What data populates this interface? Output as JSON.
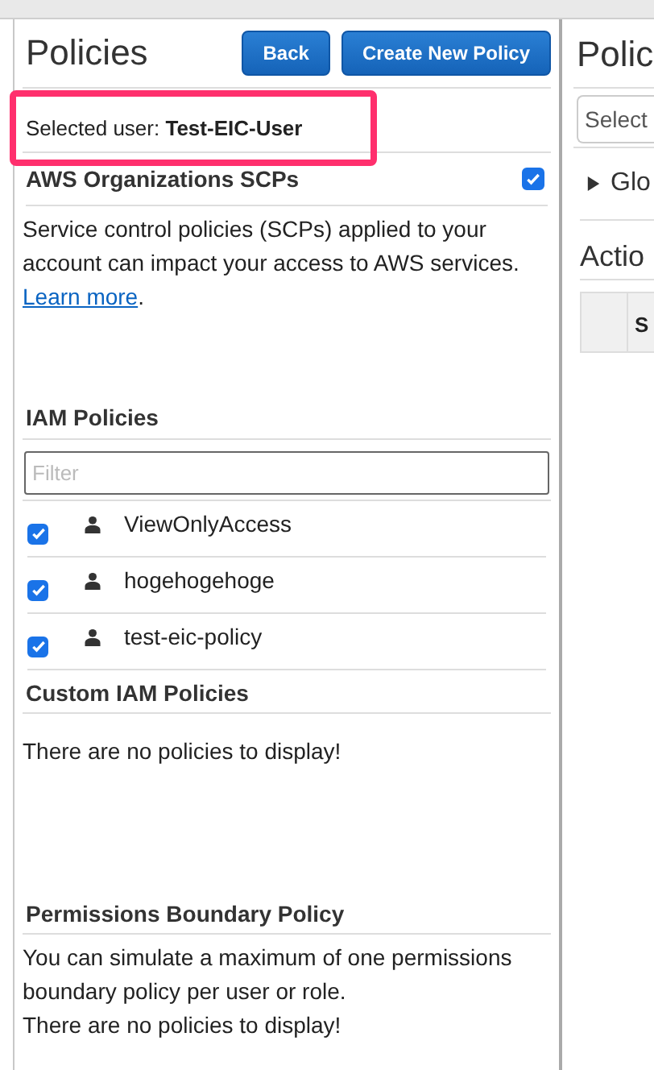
{
  "left_panel": {
    "title": "Policies",
    "buttons": [
      "Back",
      "Create New Policy"
    ],
    "selected_user": "Selected user: **Test-EIC-User**",
    "scp_section": {
      "heading": "AWS Organizations SCPs",
      "checked": true,
      "description": "Service control policies (SCPs) applied to your account can impact your access to AWS services.",
      "link": "Learn more",
      "after_link": "."
    },
    "iam_section": {
      "heading": "IAM Policies",
      "filter": {
        "placeholder": "Filter"
      },
      "policies": [
        {
          "name": "ViewOnlyAccess",
          "checked": true
        },
        {
          "name": "hogehogehoge",
          "checked": true
        },
        {
          "name": "test-eic-policy",
          "checked": true
        }
      ]
    },
    "custom_section": {
      "heading": "Custom IAM Policies",
      "message": "There are no policies to display!"
    },
    "boundary_section": {
      "heading": "Permissions Boundary Policy",
      "description": "You can simulate a maximum of one permissions boundary policy per user or role.",
      "message": "There are no policies to display!"
    }
  },
  "right_panel": {
    "title": "Polic",
    "select": {
      "placeholder": "Select"
    },
    "group": {
      "label": "Glo",
      "expanded": false
    },
    "actions_heading": "Actio",
    "table": {
      "columns": [
        "S"
      ]
    }
  }
}
